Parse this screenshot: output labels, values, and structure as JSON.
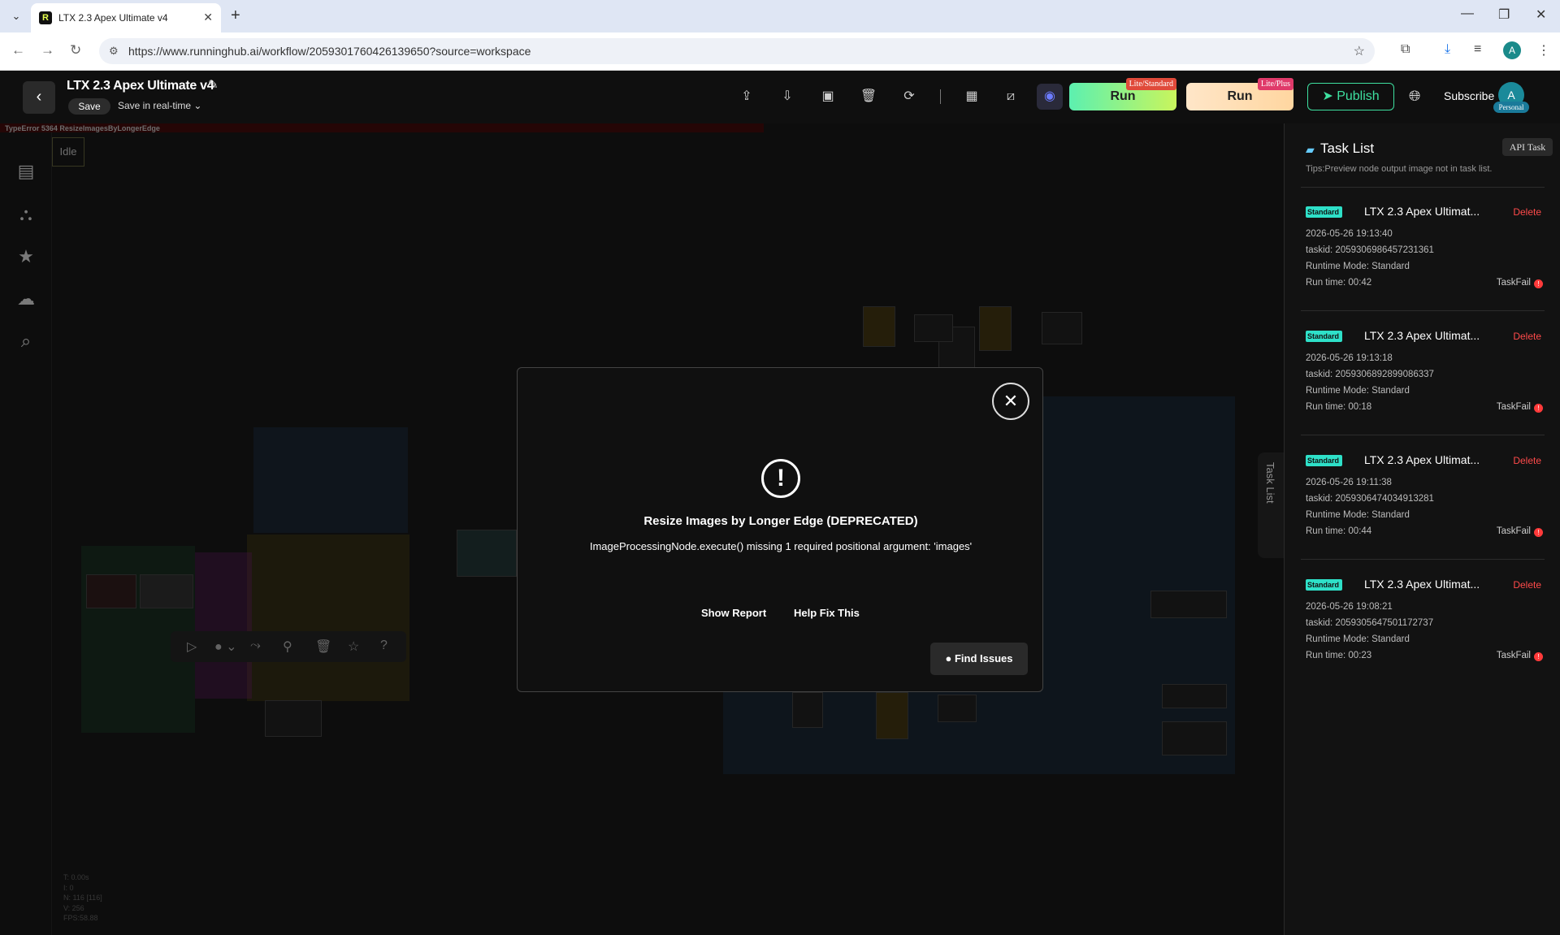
{
  "browser": {
    "tab_title": "LTX 2.3 Apex Ultimate v4",
    "url": "https://www.runninghub.ai/workflow/2059301760426139650?source=workspace"
  },
  "header": {
    "workflow_title": "LTX 2.3 Apex Ultimate v4",
    "save_label": "Save",
    "save_mode": "Save in real-time",
    "run_standard_label": "Run",
    "run_standard_badge": "Lite/Standard",
    "run_plus_label": "Run",
    "run_plus_badge": "Lite/Plus",
    "publish_label": "Publish",
    "subscribe_label": "Subscribe",
    "avatar_initial": "A",
    "avatar_badge": "Personal"
  },
  "canvas": {
    "error_banner": "TypeError 5364 ResizeImagesByLongerEdge",
    "status": "Idle",
    "stats": [
      "T: 0.00s",
      "I: 0",
      "N: 116 [116]",
      "V: 256",
      "FPS:58.88"
    ],
    "tasklist_tab": "Task List"
  },
  "modal": {
    "title": "Resize Images by Longer Edge (DEPRECATED)",
    "message": "ImageProcessingNode.execute() missing 1 required positional argument: 'images'",
    "show_report": "Show Report",
    "help_fix": "Help Fix This",
    "find_issues": "Find Issues"
  },
  "task_panel": {
    "title": "Task List",
    "api_task": "API Task",
    "tips": "Tips:Preview node output image not in task list.",
    "tasks": [
      {
        "badge": "Standard",
        "name": "LTX 2.3 Apex Ultimat...",
        "delete": "Delete",
        "date": "2026-05-26 19:13:40",
        "taskid": "taskid: 2059306986457231361",
        "mode": "Runtime Mode: Standard",
        "runtime": "Run time: 00:42",
        "status": "TaskFail"
      },
      {
        "badge": "Standard",
        "name": "LTX 2.3 Apex Ultimat...",
        "delete": "Delete",
        "date": "2026-05-26 19:13:18",
        "taskid": "taskid: 2059306892899086337",
        "mode": "Runtime Mode: Standard",
        "runtime": "Run time: 00:18",
        "status": "TaskFail"
      },
      {
        "badge": "Standard",
        "name": "LTX 2.3 Apex Ultimat...",
        "delete": "Delete",
        "date": "2026-05-26 19:11:38",
        "taskid": "taskid: 2059306474034913281",
        "mode": "Runtime Mode: Standard",
        "runtime": "Run time: 00:44",
        "status": "TaskFail"
      },
      {
        "badge": "Standard",
        "name": "LTX 2.3 Apex Ultimat...",
        "delete": "Delete",
        "date": "2026-05-26 19:08:21",
        "taskid": "taskid: 2059305647501172737",
        "mode": "Runtime Mode: Standard",
        "runtime": "Run time: 00:23",
        "status": "TaskFail"
      }
    ]
  }
}
